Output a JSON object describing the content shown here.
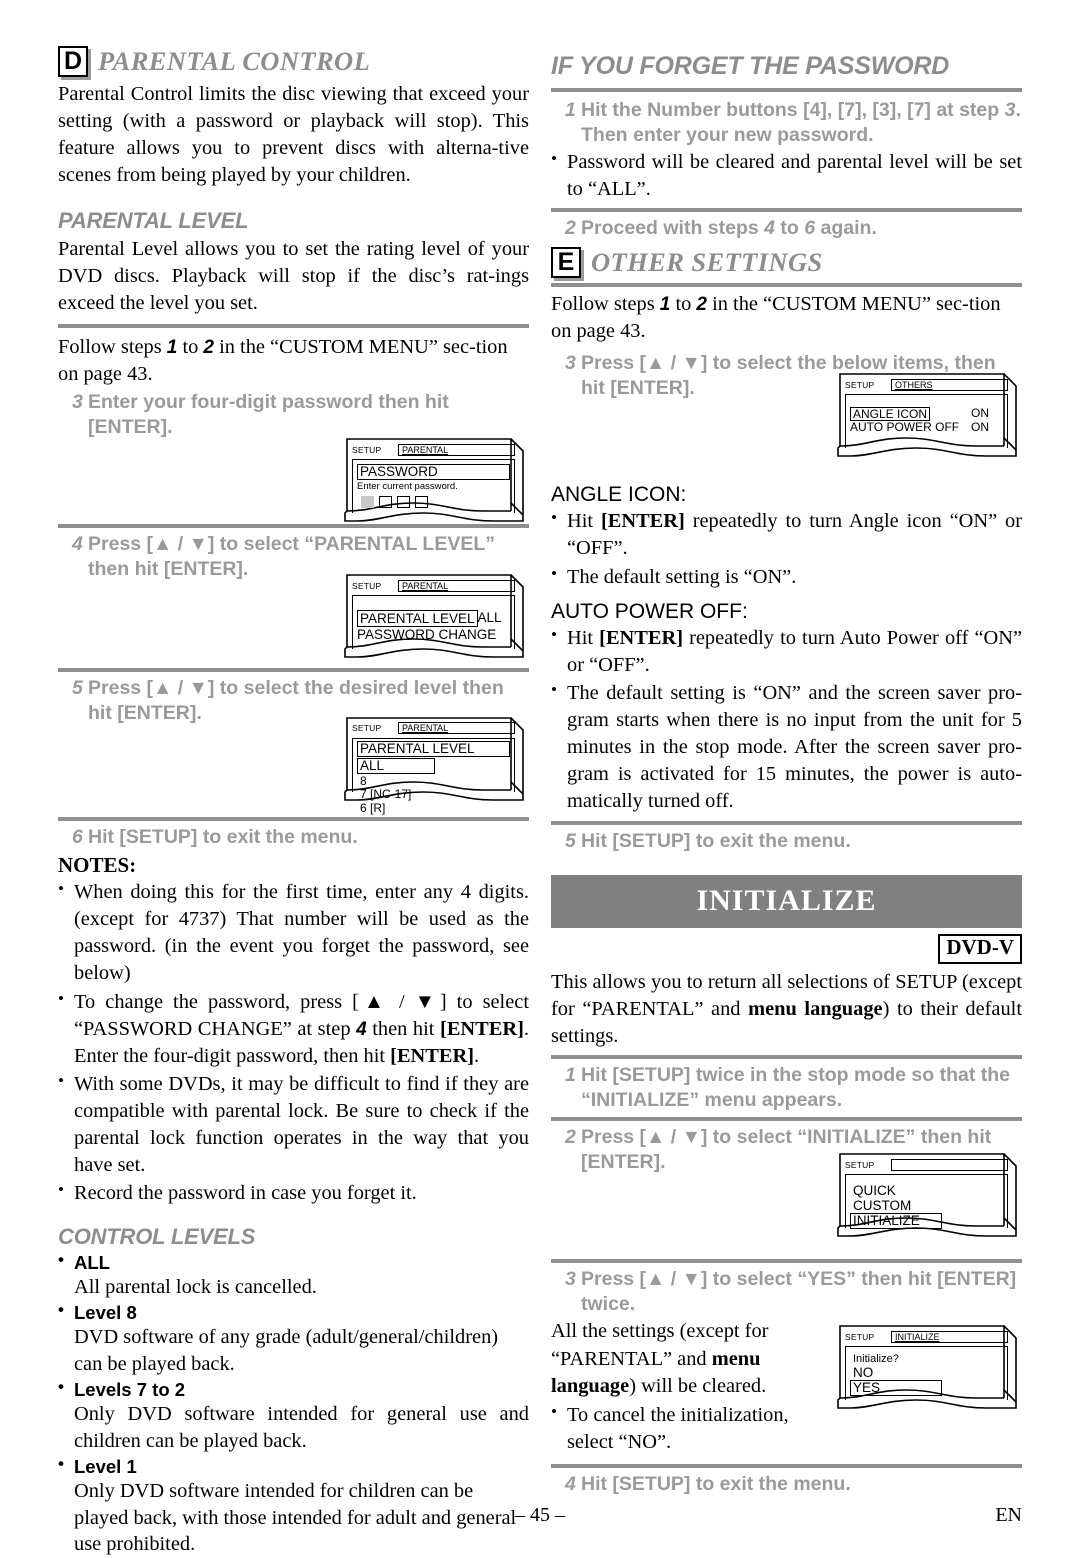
{
  "page": {
    "number": "– 45 –",
    "lang": "EN"
  },
  "left": {
    "section_d": {
      "letter": "D",
      "title": "PARENTAL CONTROL",
      "intro": "Parental Control limits the disc viewing that exceed your setting (with a password or playback will stop). This feature allows you to prevent discs with alterna-tive scenes from being played by your children."
    },
    "parental_level": {
      "title": "PARENTAL LEVEL",
      "intro": "Parental Level allows you to set the rating level of your DVD discs. Playback will stop if the disc’s rat-ings exceed the level you set.",
      "follow_pre": "Follow steps ",
      "follow_n1": "1",
      "follow_mid": " to ",
      "follow_n2": "2",
      "follow_post": " in the “CUSTOM MENU” sec-tion on page 43."
    },
    "steps": [
      {
        "num": "3",
        "text": "Enter your four-digit password then hit [ENTER]."
      },
      {
        "num": "4",
        "text": "Press [▲ / ▼] to select “PARENTAL LEVEL” then hit [ENTER]."
      },
      {
        "num": "5",
        "text": "Press [▲ / ▼] to select the desired level then hit [ENTER]."
      },
      {
        "num": "6",
        "text": "Hit [SETUP] to exit the menu."
      }
    ],
    "screens": {
      "password": {
        "setup": "SETUP",
        "title": "PARENTAL",
        "heading": "PASSWORD",
        "prompt": "Enter current password."
      },
      "parental_menu": {
        "setup": "SETUP",
        "title": "PARENTAL",
        "row1": "PARENTAL LEVEL",
        "row1_value": "ALL",
        "row2": "PASSWORD CHANGE"
      },
      "level_list": {
        "setup": "SETUP",
        "title": "PARENTAL",
        "heading": "PARENTAL LEVEL",
        "items": [
          "ALL",
          "8",
          "7 [NC-17]",
          "6 [R]"
        ]
      }
    },
    "notes": {
      "head": "NOTES:",
      "items": [
        "When doing this for the first time, enter any 4 digits. (except for 4737) That number will be used as the password. (in the event you forget the password, see below)",
        "With some DVDs, it may be difficult to find if they are compatible with parental lock. Be sure to check if the parental lock function operates in the way that you have set.",
        "Record the password in case you forget it."
      ],
      "change_a": "To change the password, press [▲ / ▼] to select “PASSWORD CHANGE” at step ",
      "change_n": "4",
      "change_b": " then hit ",
      "change_enter1": "[ENTER]",
      "change_c": ". Enter the four-digit password, then hit ",
      "change_enter2": "[ENTER]",
      "change_d": "."
    },
    "control_levels": {
      "title": "CONTROL LEVELS",
      "items": [
        {
          "label": "ALL",
          "desc": "All parental lock is cancelled."
        },
        {
          "label": "Level 8",
          "desc": "DVD software of any grade (adult/general/children) can be played back."
        },
        {
          "label": "Levels 7 to 2",
          "desc": "Only DVD software intended for general use and children can be played back."
        },
        {
          "label": "Level 1",
          "desc": "Only DVD software intended for children can be played back, with those intended for adult and general use prohibited."
        }
      ]
    }
  },
  "right": {
    "forgot": {
      "title": "IF YOU FORGET THE PASSWORD",
      "step1_num": "1",
      "step1_a": "Hit the Number buttons [4], [7], [3], [7] at step ",
      "step1_n": "3",
      "step1_b": ". Then enter your new password.",
      "bullet": "Password will be cleared and parental level will be set to “ALL”.",
      "step2_num": "2",
      "step2_a": "Proceed with steps ",
      "step2_n1": "4",
      "step2_mid": " to ",
      "step2_n2": "6",
      "step2_b": " again."
    },
    "section_e": {
      "letter": "E",
      "title": "OTHER SETTINGS",
      "follow_pre": "Follow steps ",
      "follow_n1": "1",
      "follow_mid": " to ",
      "follow_n2": "2",
      "follow_post": " in the “CUSTOM MENU” sec-tion on page 43.",
      "step3_num": "3",
      "step3_text": "Press [▲ / ▼] to select the below items, then hit [ENTER].",
      "screen": {
        "setup": "SETUP",
        "title": "OTHERS",
        "row1": "ANGLE ICON",
        "row1_value": "ON",
        "row2": "AUTO POWER OFF",
        "row2_value": "ON"
      },
      "angle_icon": {
        "head": "ANGLE ICON:",
        "b1_a": "Hit ",
        "b1_enter": "[ENTER]",
        "b1_b": " repeatedly to turn Angle icon “ON” or “OFF”.",
        "b2": "The default setting is “ON”."
      },
      "auto_power": {
        "head": "AUTO POWER OFF:",
        "b1_a": "Hit ",
        "b1_enter": "[ENTER]",
        "b1_b": " repeatedly to turn Auto Power off “ON” or “OFF”.",
        "b2": "The default setting is “ON” and the screen saver pro-gram starts when there is no input from the unit for 5 minutes in the stop mode. After the screen saver pro-gram is activated for 15 minutes, the power is auto-matically turned off."
      },
      "step5_num": "5",
      "step5_text": "Hit [SETUP] to exit the menu."
    },
    "initialize": {
      "banner": "INITIALIZE",
      "badge": "DVD-V",
      "intro_a": "This allows you to return all selections of SETUP (except for “PARENTAL” and ",
      "intro_bold": "menu language",
      "intro_b": ") to their default settings.",
      "step1_num": "1",
      "step1_text": "Hit [SETUP] twice in the stop mode so that the “INITIALIZE” menu appears.",
      "step2_num": "2",
      "step2_text": "Press [▲ / ▼] to select “INITIALIZE” then hit [ENTER].",
      "screen_menu": {
        "setup": "SETUP",
        "title": "",
        "items": [
          "QUICK",
          "CUSTOM",
          "INITIALIZE"
        ]
      },
      "step3_num": "3",
      "step3_text": "Press [▲ / ▼] to select “YES” then hit [ENTER] twice.",
      "result_a": "All the settings (except for “PARENTAL” and ",
      "result_bold": "menu language",
      "result_b": ") will be cleared.",
      "cancel": "To cancel the initialization, select “NO”.",
      "screen_confirm": {
        "setup": "SETUP",
        "title": "INITIALIZE",
        "prompt": "Initialize?",
        "no": "NO",
        "yes": "YES"
      },
      "step4_num": "4",
      "step4_text": "Hit [SETUP] to exit the menu."
    }
  }
}
